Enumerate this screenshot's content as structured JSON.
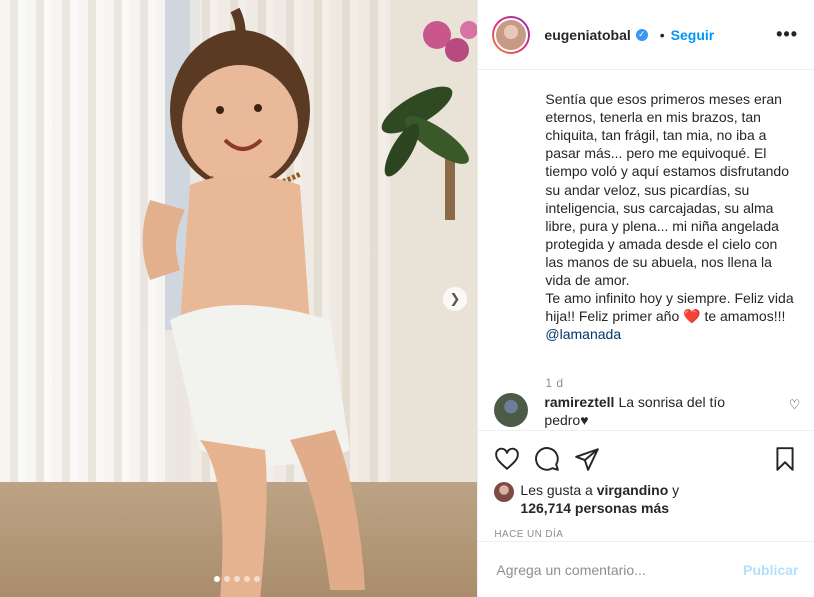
{
  "header": {
    "username": "eugeniatobal",
    "separator": "•",
    "follow_label": "Seguir",
    "more_label": "•••"
  },
  "caption": {
    "text": "Sentía que esos primeros meses eran eternos, tenerla en mis brazos, tan chiquita, tan frágil, tan mia, no iba a pasar más... pero me equivoqué. El tiempo voló y aquí estamos disfrutando su andar veloz, sus picardías, su inteligencia, sus carcajadas, su alma libre, pura y plena... mi niña angelada protegida y amada desde el cielo con las manos de su abuela, nos llena la vida de amor.\nTe amo infinito hoy y siempre. Feliz vida hija!! Feliz primer año ❤️ te amamos!!!",
    "mention": "@lamanada",
    "age": "1 d"
  },
  "comment": {
    "user": "ramireztell",
    "text": "La sonrisa del tío pedro♥"
  },
  "likes": {
    "prefix": "Les gusta a",
    "user": "virgandino",
    "conj": "y",
    "count": "126,714 personas más"
  },
  "date": "HACE UN DÍA",
  "add_comment": {
    "placeholder": "Agrega un comentario...",
    "publish_label": "Publicar"
  },
  "carousel": {
    "total": 5,
    "active": 0
  },
  "colors": {
    "link": "#0095f6",
    "verified": "#3897f0",
    "publish_disabled": "#b2dffc"
  }
}
